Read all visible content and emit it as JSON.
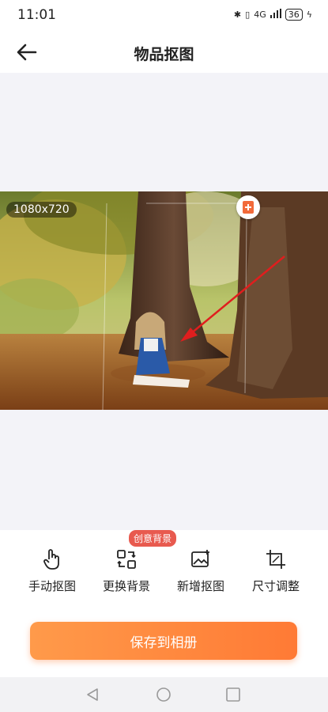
{
  "status_bar": {
    "time": "11:01",
    "network": "4G",
    "battery": "36",
    "icons": [
      "bluetooth-icon",
      "vibrate-icon",
      "signal-icon",
      "battery-icon",
      "charging-icon"
    ]
  },
  "header": {
    "title": "物品抠图",
    "back_icon": "arrow-left-icon"
  },
  "image": {
    "dimensions": "1080x720"
  },
  "tools": {
    "badge": "创意背景",
    "manual_cutout": "手动抠图",
    "change_background": "更换背景",
    "add_cutout": "新增抠图",
    "size_adjust": "尺寸调整"
  },
  "save_button": "保存到相册",
  "colors": {
    "accent": "#ff8a3d",
    "badge": "#e85a4f",
    "annotation_arrow": "#e01e1e"
  }
}
